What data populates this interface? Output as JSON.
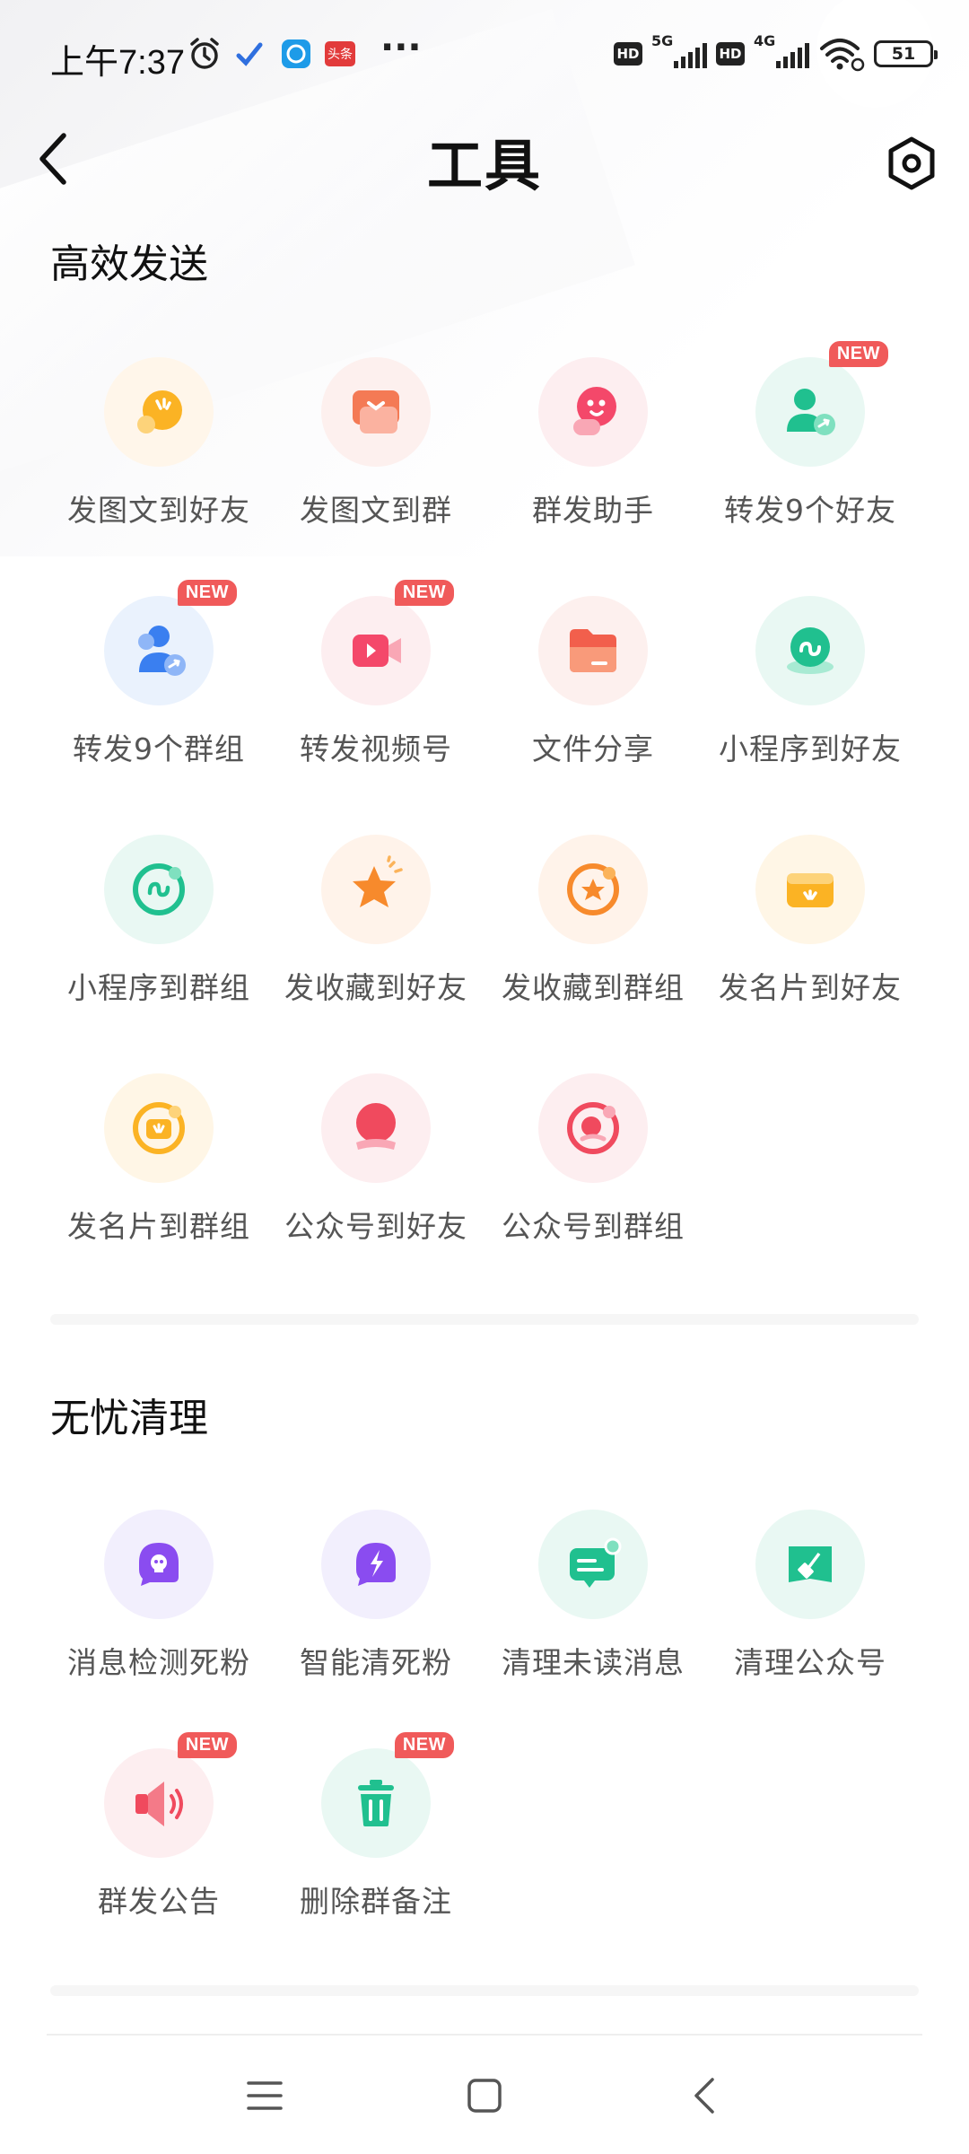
{
  "status_bar": {
    "time": "上午7:37",
    "hd_label": "HD",
    "network_1": "5G",
    "network_2": "4G",
    "battery": "51",
    "more": "···",
    "app_notification_text": "头条"
  },
  "header": {
    "title": "工具"
  },
  "sections": [
    {
      "title": "高效发送",
      "items": [
        {
          "label": "发图文到好友",
          "icon": "image-text-friend-icon",
          "new": false
        },
        {
          "label": "发图文到群",
          "icon": "image-text-group-icon",
          "new": false
        },
        {
          "label": "群发助手",
          "icon": "mass-send-assistant-icon",
          "new": false
        },
        {
          "label": "转发9个好友",
          "icon": "forward-friends-icon",
          "new": true
        },
        {
          "label": "转发9个群组",
          "icon": "forward-groups-icon",
          "new": true
        },
        {
          "label": "转发视频号",
          "icon": "forward-video-icon",
          "new": true
        },
        {
          "label": "文件分享",
          "icon": "file-share-icon",
          "new": false
        },
        {
          "label": "小程序到好友",
          "icon": "miniprogram-friend-icon",
          "new": false
        },
        {
          "label": "小程序到群组",
          "icon": "miniprogram-group-icon",
          "new": false
        },
        {
          "label": "发收藏到好友",
          "icon": "favorite-friend-icon",
          "new": false
        },
        {
          "label": "发收藏到群组",
          "icon": "favorite-group-icon",
          "new": false
        },
        {
          "label": "发名片到好友",
          "icon": "card-friend-icon",
          "new": false
        },
        {
          "label": "发名片到群组",
          "icon": "card-group-icon",
          "new": false
        },
        {
          "label": "公众号到好友",
          "icon": "official-account-friend-icon",
          "new": false
        },
        {
          "label": "公众号到群组",
          "icon": "official-account-group-icon",
          "new": false
        }
      ]
    },
    {
      "title": "无忧清理",
      "items": [
        {
          "label": "消息检测死粉",
          "icon": "detect-dead-fans-icon",
          "new": false
        },
        {
          "label": "智能清死粉",
          "icon": "smart-clean-fans-icon",
          "new": false
        },
        {
          "label": "清理未读消息",
          "icon": "clear-unread-icon",
          "new": false
        },
        {
          "label": "清理公众号",
          "icon": "clean-official-accounts-icon",
          "new": false
        },
        {
          "label": "群发公告",
          "icon": "group-announcement-icon",
          "new": true
        },
        {
          "label": "删除群备注",
          "icon": "delete-group-remark-icon",
          "new": true
        }
      ]
    }
  ],
  "badge_text": "NEW",
  "colors": {
    "badge": "#f05a5a",
    "title": "#111111",
    "label": "#555555"
  }
}
